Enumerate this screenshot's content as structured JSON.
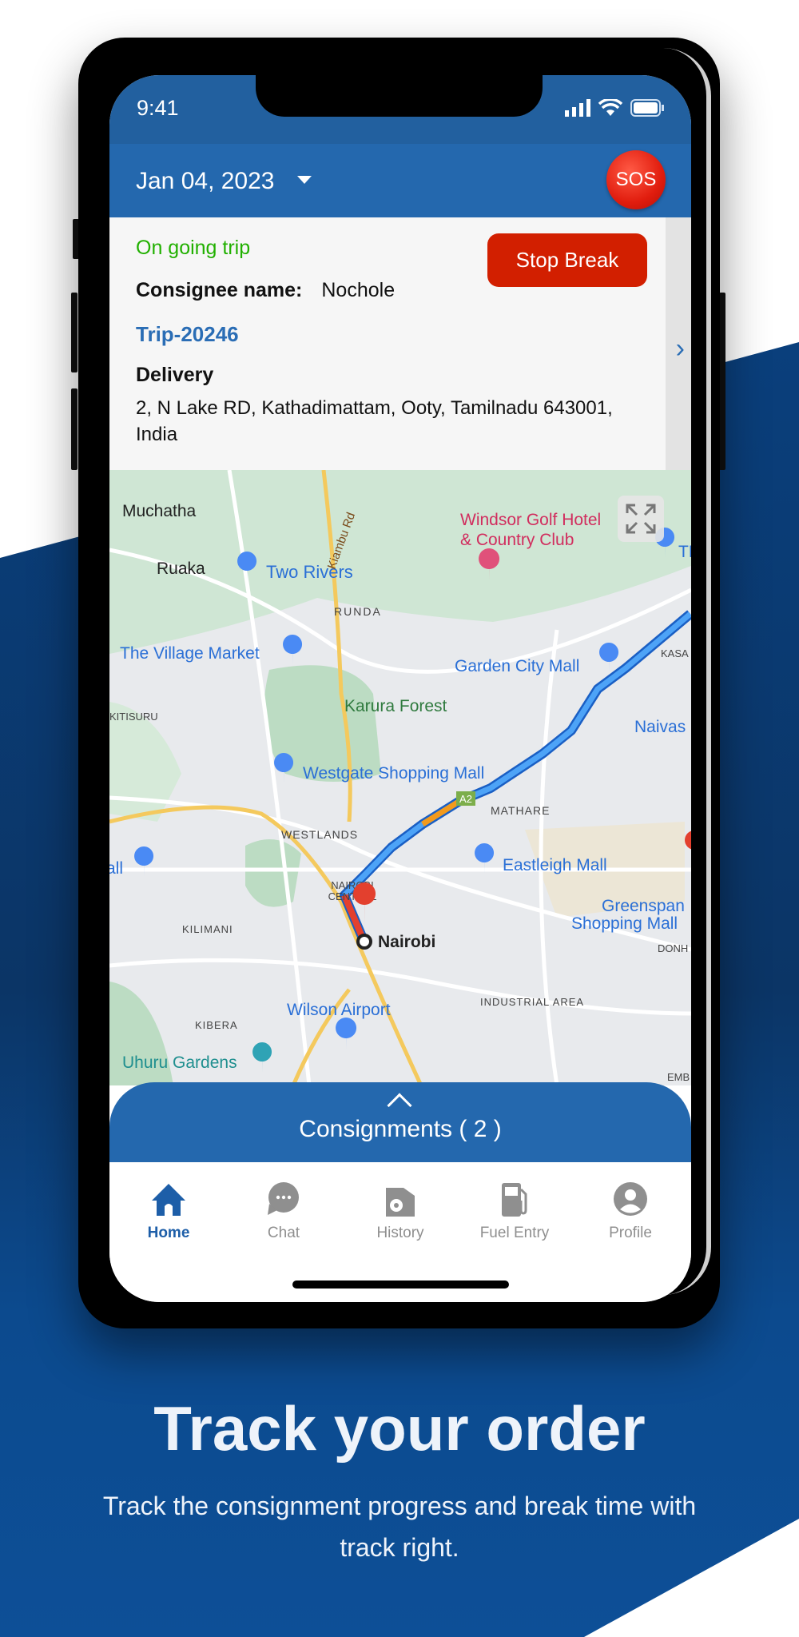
{
  "colors": {
    "brand_blue": "#2468ae",
    "danger_red": "#d21f00",
    "ongoing_green": "#21b000",
    "link_blue": "#2a6db5",
    "background_blue": "#0c4a8e"
  },
  "status_bar": {
    "time": "9:41",
    "icons": [
      "signal-icon",
      "wifi-icon",
      "battery-icon"
    ]
  },
  "header": {
    "date": "Jan 04, 2023",
    "sos_label": "SOS"
  },
  "trip_card": {
    "status": "On going trip",
    "consignee_label": "Consignee name:",
    "consignee_value": "Nochole",
    "trip_id": "Trip-20246",
    "delivery_label": "Delivery",
    "address": "2, N Lake RD, Kathadimattam, Ooty, Tamilnadu 643001, India",
    "stop_break_label": "Stop Break"
  },
  "map": {
    "labels": {
      "muchatha": "Muchatha",
      "ruaka": "Ruaka",
      "two_rivers": "Two Rivers",
      "windsor1": "Windsor Golf Hotel",
      "windsor2": "& Country Club",
      "kiambu": "Kiambu Rd",
      "runda": "RUNDA",
      "village_market": "The Village Market",
      "garden_city": "Garden City Mall",
      "kasa": "KASA",
      "karura": "Karura Forest",
      "kitisuru": "KITISURU",
      "naivas": "Naivas",
      "westgate": "Westgate Shopping Mall",
      "a2": "A2",
      "mathare": "MATHARE",
      "westlands": "WESTLANDS",
      "eastleigh": "Eastleigh Mall",
      "all": "all",
      "nairobi_central1": "NAIROBI",
      "nairobi_central2": "CENTRAL",
      "greenspan1": "Greenspan",
      "greenspan2": "Shopping Mall",
      "kilimani": "KILIMANI",
      "nairobi": "Nairobi",
      "donh": "DONH",
      "industrial": "INDUSTRIAL AREA",
      "wilson": "Wilson Airport",
      "kibera": "KIBERA",
      "uhuru": "Uhuru Gardens",
      "emb": "EMB",
      "tr": "TR"
    }
  },
  "consignments": {
    "label": "Consignments ( 2 )"
  },
  "nav": {
    "items": [
      {
        "label": "Home",
        "icon": "home-icon",
        "active": true
      },
      {
        "label": "Chat",
        "icon": "chat-icon"
      },
      {
        "label": "History",
        "icon": "history-icon"
      },
      {
        "label": "Fuel Entry",
        "icon": "fuel-icon"
      },
      {
        "label": "Profile",
        "icon": "profile-icon"
      }
    ]
  },
  "promo": {
    "title": "Track your order",
    "subtitle": "Track the consignment progress and break time with track right."
  }
}
